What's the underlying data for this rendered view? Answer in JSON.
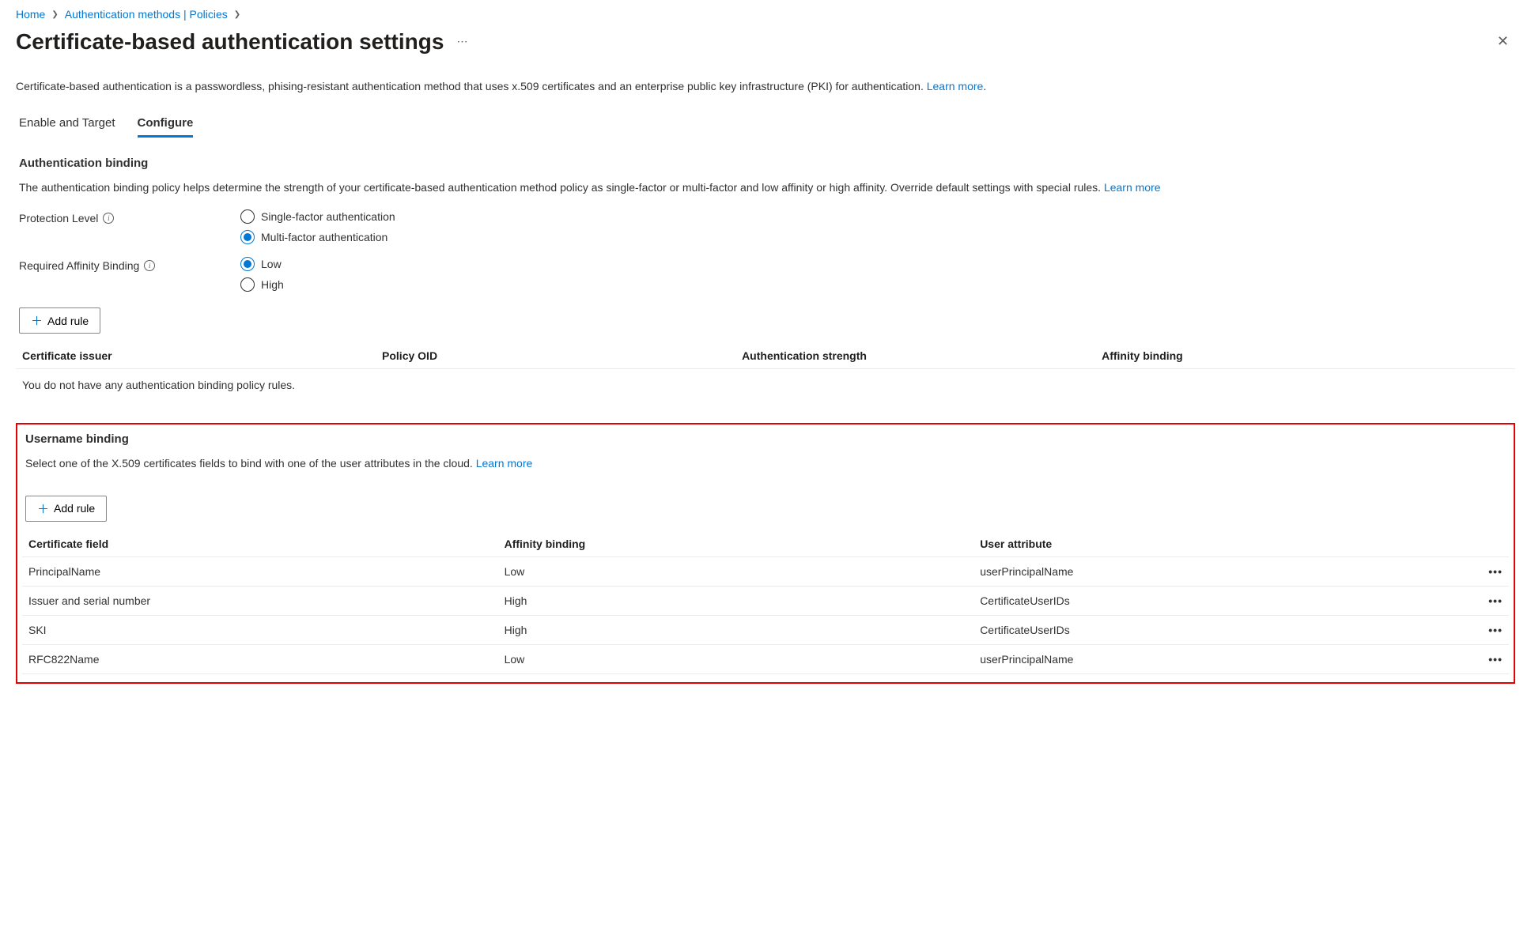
{
  "breadcrumb": {
    "items": [
      {
        "label": "Home"
      },
      {
        "label": "Authentication methods | Policies"
      }
    ]
  },
  "title": "Certificate-based authentication settings",
  "description_text": "Certificate-based authentication is a passwordless, phising-resistant authentication method that uses x.509 certificates and an enterprise public key infrastructure (PKI) for authentication. ",
  "learn_more": "Learn more",
  "tabs": {
    "enable": "Enable and Target",
    "configure": "Configure"
  },
  "auth_binding": {
    "heading": "Authentication binding",
    "desc": "The authentication binding policy helps determine the strength of your certificate-based authentication method policy as single-factor or multi-factor and low affinity or high affinity. Override default settings with special rules.  ",
    "protection_label": "Protection Level",
    "affinity_label": "Required Affinity Binding",
    "radio_single": "Single-factor authentication",
    "radio_multi": "Multi-factor authentication",
    "radio_low": "Low",
    "radio_high": "High",
    "add_rule": "Add rule",
    "cols": {
      "issuer": "Certificate issuer",
      "oid": "Policy OID",
      "strength": "Authentication strength",
      "affinity": "Affinity binding"
    },
    "empty": "You do not have any authentication binding policy rules."
  },
  "username_binding": {
    "heading": "Username binding",
    "desc": "Select one of the X.509 certificates fields to bind with one of the user attributes in the cloud.  ",
    "add_rule": "Add rule",
    "cols": {
      "field": "Certificate field",
      "affinity": "Affinity binding",
      "user_attr": "User attribute"
    },
    "rows": [
      {
        "field": "PrincipalName",
        "affinity": "Low",
        "user_attr": "userPrincipalName"
      },
      {
        "field": "Issuer and serial number",
        "affinity": "High",
        "user_attr": "CertificateUserIDs"
      },
      {
        "field": "SKI",
        "affinity": "High",
        "user_attr": "CertificateUserIDs"
      },
      {
        "field": "RFC822Name",
        "affinity": "Low",
        "user_attr": "userPrincipalName"
      }
    ]
  },
  "period": "."
}
